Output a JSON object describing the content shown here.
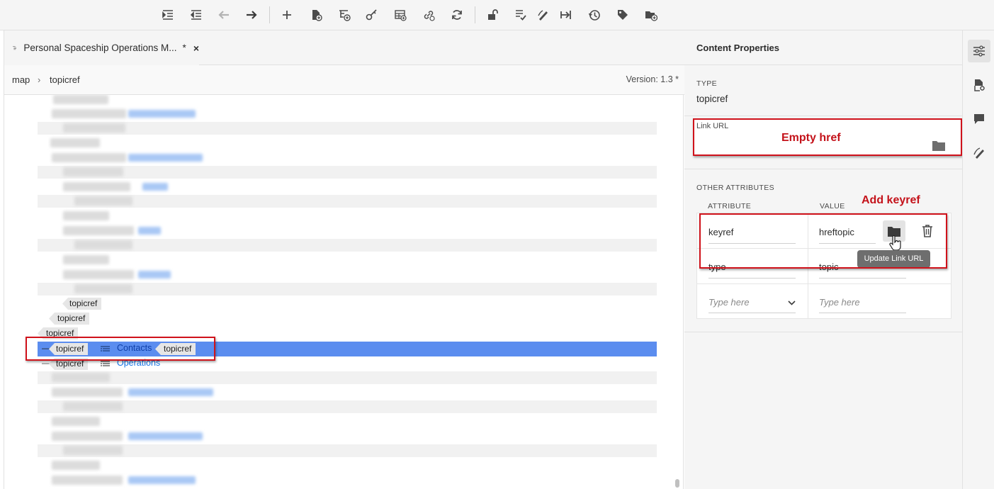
{
  "toolbar": {
    "icons": [
      "indent-icon",
      "outdent-icon",
      "move-left-icon",
      "move-right-icon",
      "add-icon",
      "new-topic-icon",
      "insert-topicref-icon",
      "key-icon",
      "insert-table-icon",
      "link-icon",
      "refresh-icon",
      "unlock-icon",
      "checklist-icon",
      "edit-sign-icon",
      "export-icon",
      "history-icon",
      "tag-icon",
      "new-folder-icon"
    ]
  },
  "editor": {
    "tab_title": "Personal Spaceship Operations M...",
    "tab_modified": "*",
    "tab_close": "×",
    "breadcrumb": [
      "map",
      "topicref"
    ],
    "breadcrumb_sep": "›",
    "version": "Version: 1.3 *"
  },
  "tree": {
    "topicref_label": "topicref",
    "selected_link": "Contacts",
    "operations_link": "Operations",
    "collapse_glyph": "—"
  },
  "annotations": {
    "empty_href": "Empty href",
    "add_keyref": "Add keyref"
  },
  "properties": {
    "title": "Content Properties",
    "type_label": "TYPE",
    "type_value": "topicref",
    "link_url_label": "Link URL",
    "other_attributes_label": "OTHER ATTRIBUTES",
    "attribute_header": "ATTRIBUTE",
    "value_header": "VALUE",
    "rows": [
      {
        "attribute": "keyref",
        "value": "hreftopic"
      },
      {
        "attribute": "type",
        "value": "topic"
      }
    ],
    "new_attr_placeholder": "Type here",
    "new_value_placeholder": "Type here",
    "tooltip": "Update Link URL"
  },
  "rail": {
    "icons": [
      "properties-icon",
      "file-settings-icon",
      "comment-icon",
      "review-icon"
    ]
  },
  "colors": {
    "selection": "#5b8def",
    "link": "#1473e6",
    "annotation_red": "#d0121b"
  }
}
